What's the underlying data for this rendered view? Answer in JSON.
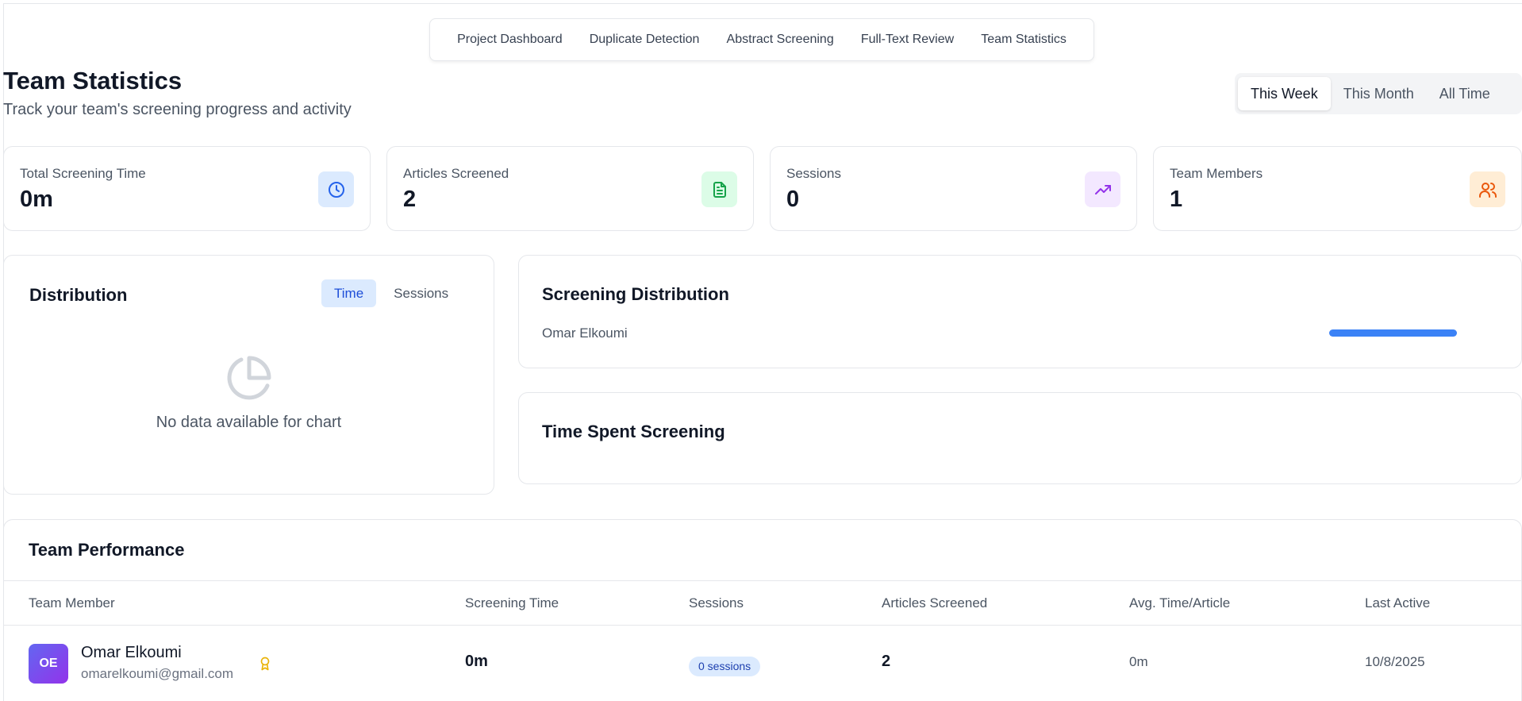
{
  "nav": {
    "items": [
      "Project Dashboard",
      "Duplicate Detection",
      "Abstract Screening",
      "Full-Text Review",
      "Team Statistics"
    ]
  },
  "header": {
    "title": "Team Statistics",
    "subtitle": "Track your team's screening progress and activity"
  },
  "range": {
    "options": [
      "This Week",
      "This Month",
      "All Time"
    ],
    "selected": "This Week"
  },
  "stats": [
    {
      "label": "Total Screening Time",
      "value": "0m",
      "icon": "clock-icon",
      "icon_color": "#2563eb",
      "icon_bg": "#dbeafe"
    },
    {
      "label": "Articles Screened",
      "value": "2",
      "icon": "document-icon",
      "icon_color": "#16a34a",
      "icon_bg": "#dcfce7"
    },
    {
      "label": "Sessions",
      "value": "0",
      "icon": "trending-up-icon",
      "icon_color": "#9333ea",
      "icon_bg": "#f3e8ff"
    },
    {
      "label": "Team Members",
      "value": "1",
      "icon": "users-icon",
      "icon_color": "#ea580c",
      "icon_bg": "#ffedd5"
    }
  ],
  "distribution": {
    "title": "Distribution",
    "tabs": [
      "Time",
      "Sessions"
    ],
    "selected": "Time",
    "empty_text": "No data available for chart",
    "icon": "pie-chart-icon"
  },
  "screening_distribution": {
    "title": "Screening Distribution",
    "rows": [
      {
        "name": "Omar Elkoumi",
        "share": 1.0
      }
    ],
    "bar_color": "#3b82f6"
  },
  "time_spent": {
    "title": "Time Spent Screening"
  },
  "performance": {
    "title": "Team Performance",
    "columns": [
      "Team Member",
      "Screening Time",
      "Sessions",
      "Articles Screened",
      "Avg. Time/Article",
      "Last Active"
    ],
    "rows": [
      {
        "initials": "OE",
        "name": "Omar Elkoumi",
        "email": "omarelkoumi@gmail.com",
        "screening_time": "0m",
        "sessions": "0 sessions",
        "articles": "2",
        "avg_time": "0m",
        "last_active": "10/8/2025",
        "badge_icon": "award-icon"
      }
    ]
  }
}
